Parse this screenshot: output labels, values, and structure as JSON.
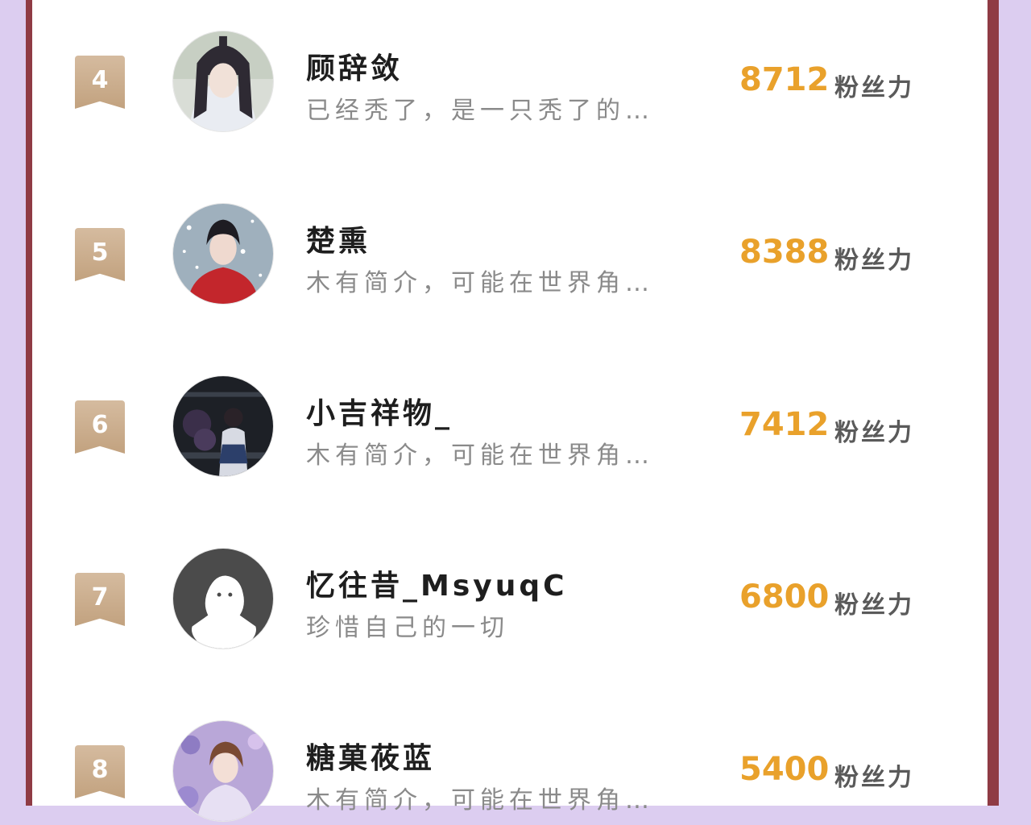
{
  "ranking": {
    "items": [
      {
        "rank": "4",
        "name": "顾辞敛",
        "bio": "已经秃了，是一只秃了的…",
        "score": "8712",
        "unit": "粉丝力",
        "avatar_icon": "long-hair-character-avatar-icon"
      },
      {
        "rank": "5",
        "name": "楚熏",
        "bio": "木有简介，可能在世界角…",
        "score": "8388",
        "unit": "粉丝力",
        "avatar_icon": "snow-red-coat-character-avatar-icon"
      },
      {
        "rank": "6",
        "name": "小吉祥物_",
        "bio": "木有简介，可能在世界角…",
        "score": "7412",
        "unit": "粉丝力",
        "avatar_icon": "night-schoolgirl-avatar-icon"
      },
      {
        "rank": "7",
        "name": "忆往昔_MsyuqC",
        "bio": "珍惜自己的一切",
        "score": "6800",
        "unit": "粉丝力",
        "avatar_icon": "default-ghost-avatar-icon"
      },
      {
        "rank": "8",
        "name": "糖菓莜蓝",
        "bio": "木有简介，可能在世界角…",
        "score": "5400",
        "unit": "粉丝力",
        "avatar_icon": "purple-floral-character-avatar-icon"
      }
    ]
  },
  "colors": {
    "background": "#dccdf0",
    "border": "#8f3b44",
    "badge": "#c9ab8a",
    "score": "#e9a12b",
    "bio": "#8a8a8a"
  }
}
